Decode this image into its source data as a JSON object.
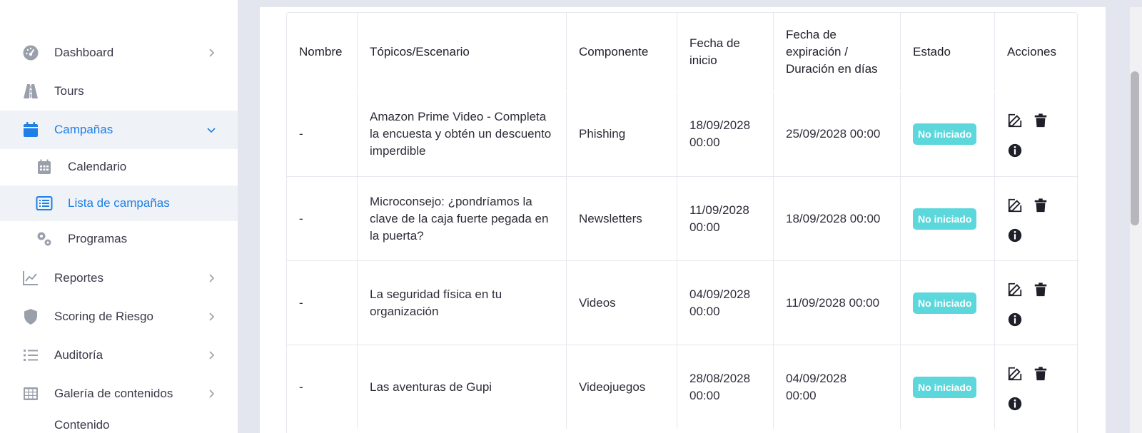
{
  "sidebar": {
    "items": [
      {
        "label": "Dashboard",
        "icon": "gauge-icon"
      },
      {
        "label": "Tours",
        "icon": "road-icon"
      },
      {
        "label": "Campañas",
        "icon": "calendar-icon"
      },
      {
        "label": "Reportes",
        "icon": "chart-line-icon"
      },
      {
        "label": "Scoring de Riesgo",
        "icon": "shield-icon"
      },
      {
        "label": "Auditoría",
        "icon": "list-icon"
      },
      {
        "label": "Galería de contenidos",
        "icon": "grid-icon"
      },
      {
        "label": "Contenido",
        "icon": "content-icon"
      }
    ],
    "subitems": [
      {
        "label": "Calendario",
        "icon": "calendar-grid-icon"
      },
      {
        "label": "Lista de campañas",
        "icon": "list-alt-icon"
      },
      {
        "label": "Programas",
        "icon": "cogs-icon"
      }
    ]
  },
  "table": {
    "headers": [
      "Nombre",
      "Tópicos/Escenario",
      "Componente",
      "Fecha de inicio",
      "Fecha de expiración / Duración en días",
      "Estado",
      "Acciones"
    ],
    "rows": [
      {
        "nombre": "-",
        "topico": "Amazon Prime Video - Completa la encuesta y obtén un descuento imperdible",
        "componente": "Phishing",
        "inicio": "18/09/2028 00:00",
        "expiracion": "25/09/2028 00:00",
        "estado": "No iniciado"
      },
      {
        "nombre": "-",
        "topico": "Microconsejo: ¿pondríamos la clave de la caja fuerte pegada en la puerta?",
        "componente": "Newsletters",
        "inicio": "11/09/2028 00:00",
        "expiracion": "18/09/2028 00:00",
        "estado": "No iniciado"
      },
      {
        "nombre": "-",
        "topico": "La seguridad física en tu organización",
        "componente": "Videos",
        "inicio": "04/09/2028 00:00",
        "expiracion": "11/09/2028 00:00",
        "estado": "No iniciado"
      },
      {
        "nombre": "-",
        "topico": "Las aventuras de Gupi",
        "componente": "Videojuegos",
        "inicio": "28/08/2028 00:00",
        "expiracion": "04/09/2028 00:00",
        "estado": "No iniciado"
      }
    ]
  },
  "colors": {
    "accent": "#1e7fe6",
    "badge": "#5cd7dc",
    "icon_gray": "#9aa0ab"
  }
}
